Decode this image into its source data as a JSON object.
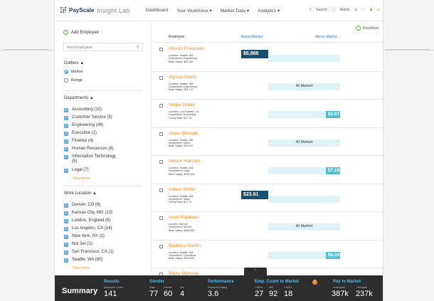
{
  "topbar": {
    "brand": "PayScale",
    "product": "Insight Lab",
    "nav": [
      "Dashboard",
      "Your Workforce ▾",
      "Market Data ▾",
      "Analytics ▾"
    ],
    "search_label": "Search",
    "admin_label": "Admin"
  },
  "sidebar": {
    "add_employee": "Add Employee",
    "find_placeholder": "Find Employees",
    "outliers_heading": "Outliers ▲",
    "outlier_options": [
      "Market",
      "Range"
    ],
    "departments_heading": "Departments ▲",
    "departments": [
      "Accounting (10)",
      "Customer Service (5)",
      "Engineering (49)",
      "Executive (1)",
      "Finance (4)",
      "Human Resources (8)",
      "Information Technology",
      "(5)",
      "Legal (7)"
    ],
    "view_more": "View more",
    "location_heading": "Work Location ▲",
    "locations": [
      "Denver, CO (8)",
      "Kansas City, MO (10)",
      "London, England (5)",
      "Los Angeles, CA (14)",
      "New York, NY (1)",
      "Not Set (1)",
      "San Francisco, CA (1)",
      "Seattle, WA (80)"
    ]
  },
  "main": {
    "download": "Download",
    "col_employee": "Employee",
    "col_below": "Below Market",
    "col_above": "Above Market",
    "employees": [
      {
        "name": "Allison Freeman",
        "line1": "Location: Seattle, WA",
        "line2": "Department: Engineering",
        "line3": "Base Salary: $62,000",
        "value": "$6,888",
        "side": "below"
      },
      {
        "name": "Alyssa Smith",
        "line1": "Location: Seattle, WA",
        "line2": "Department: Engineering",
        "line3": "Base Salary: $93,170",
        "value": "At Market",
        "side": "at"
      },
      {
        "name": "Angie Drake",
        "line1": "Location: Los Angeles, CA",
        "line2": "Department: Accounting",
        "line3": "Hourly Rate: $27.75",
        "value": "$2.67",
        "side": "above",
        "fill": 0.2
      },
      {
        "name": "Anne Stewart",
        "line1": "Location: Seattle, WA",
        "line2": "Department: Sales",
        "line3": "Base Salary: $75,000",
        "value": "At Market",
        "side": "at"
      },
      {
        "name": "Anson Hansen",
        "line1": "Location: Seattle, WA",
        "line2": "Department: Legal",
        "line3": "Base Salary: $205,500",
        "value": "$7,195",
        "side": "above",
        "fill": 0.2
      },
      {
        "name": "Arthur Wolfe",
        "line1": "Location: Seattle, WA",
        "line2": "Department: Sales",
        "line3": "Hourly Rate: $17.79",
        "value": "$23.61",
        "side": "below"
      },
      {
        "name": "Arun Rajahani",
        "line1": "Location: Not set",
        "line2": "Department: Not set",
        "line3": "Base Salary: $166,802",
        "value": "At Market",
        "side": "at"
      },
      {
        "name": "Barbara Martin",
        "line1": "Location: Seattle, WA",
        "line2": "Department: Operations",
        "line3": "Base Salary: $110,500",
        "value": "$6,241",
        "side": "above",
        "fill": 0.2
      },
      {
        "name": "Barry Melrose",
        "line1": "",
        "line2": "",
        "line3": "",
        "value": "",
        "side": "none"
      }
    ]
  },
  "summary": {
    "title": "Summary",
    "results_h": "Results",
    "results_sub": "Employee Count",
    "results_v": "141",
    "gender_h": "Gender",
    "gender_subs": [
      "Male",
      "Female",
      "N/A"
    ],
    "gender_v": [
      "77",
      "60",
      "4"
    ],
    "perf_h": "Performance",
    "perf_sub": "Employee Rating",
    "perf_v": "3.6",
    "emp_h": "Emp. Count to Market",
    "emp_subs": [
      "<100%",
      "Mid",
      ">100%"
    ],
    "emp_v": [
      "27",
      "92",
      "18"
    ],
    "pay_h": "Pay to Market",
    "pay_subs": [
      "Underpaid",
      "Overpaid"
    ],
    "pay_v": [
      "387k",
      "237k"
    ]
  }
}
